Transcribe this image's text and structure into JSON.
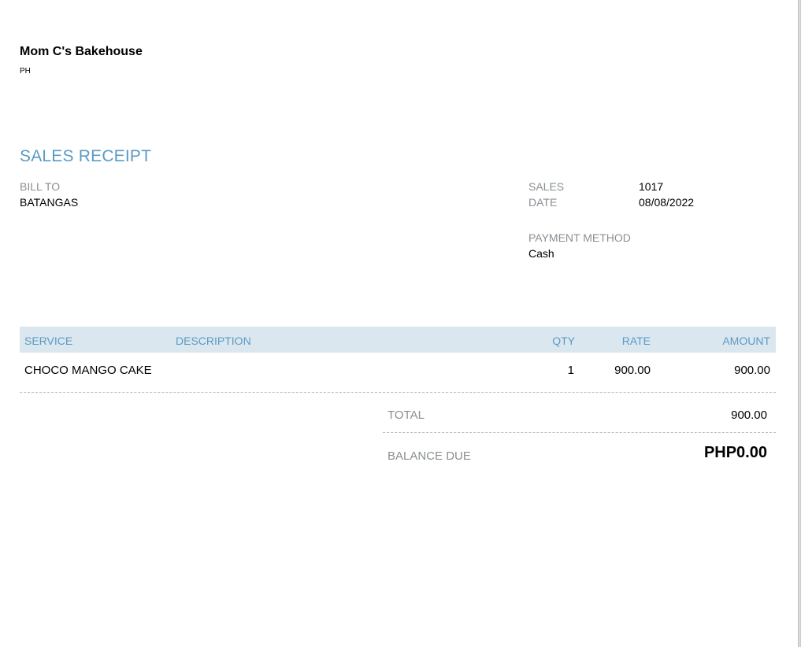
{
  "company": {
    "name": "Mom C's Bakehouse",
    "country": "PH"
  },
  "document": {
    "title": "SALES RECEIPT"
  },
  "bill_to": {
    "label": "BILL TO",
    "value": "BATANGAS"
  },
  "meta": {
    "sales_label": "SALES",
    "sales_value": "1017",
    "date_label": "DATE",
    "date_value": "08/08/2022",
    "payment_method_label": "PAYMENT METHOD",
    "payment_method_value": "Cash"
  },
  "table": {
    "headers": {
      "service": "SERVICE",
      "description": "DESCRIPTION",
      "qty": "QTY",
      "rate": "RATE",
      "amount": "AMOUNT"
    },
    "rows": [
      {
        "service": "CHOCO MANGO CAKE",
        "description": "",
        "qty": "1",
        "rate": "900.00",
        "amount": "900.00"
      }
    ]
  },
  "totals": {
    "total_label": "TOTAL",
    "total_value": "900.00",
    "balance_due_label": "BALANCE DUE",
    "balance_due_value": "PHP0.00"
  },
  "colors": {
    "accent": "#5b9ac4",
    "header_bg": "#dbe7ef",
    "muted_text": "#8a8f94"
  }
}
